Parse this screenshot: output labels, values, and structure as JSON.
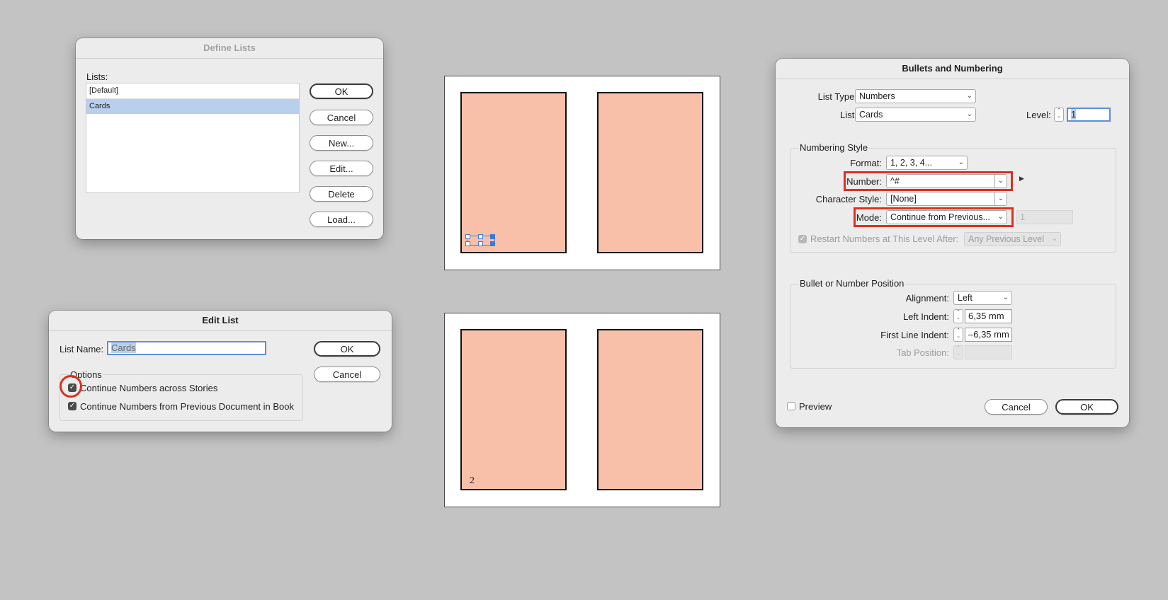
{
  "define_lists": {
    "title": "Define Lists",
    "lists_label": "Lists:",
    "items": [
      "[Default]",
      "Cards"
    ],
    "selected_index": 1,
    "buttons": {
      "ok": "OK",
      "cancel": "Cancel",
      "new": "New...",
      "edit": "Edit...",
      "delete": "Delete",
      "load": "Load..."
    }
  },
  "edit_list": {
    "title": "Edit List",
    "name_label": "List Name:",
    "name_value": "Cards",
    "options_title": "Options",
    "option1_label": "Continue Numbers across Stories",
    "option1_checked": true,
    "option2_label": "Continue Numbers from Previous Document in Book",
    "option2_checked": true,
    "ok": "OK",
    "cancel": "Cancel"
  },
  "pages": {
    "bottom_card_number": "2"
  },
  "bullets": {
    "title": "Bullets and Numbering",
    "list_type_label": "List Type:",
    "list_type_value": "Numbers",
    "list_label": "List:",
    "list_value": "Cards",
    "level_label": "Level:",
    "level_value": "1",
    "numbering_style_title": "Numbering Style",
    "format_label": "Format:",
    "format_value": "1, 2, 3, 4...",
    "number_label": "Number:",
    "number_value": "^#",
    "char_style_label": "Character Style:",
    "char_style_value": "[None]",
    "mode_label": "Mode:",
    "mode_value": "Continue from Previous...",
    "mode_start_value": "1",
    "restart_label": "Restart Numbers at This Level After:",
    "restart_value": "Any Previous Level",
    "position_title": "Bullet or Number Position",
    "alignment_label": "Alignment:",
    "alignment_value": "Left",
    "left_indent_label": "Left Indent:",
    "left_indent_value": "6,35 mm",
    "first_line_label": "First Line Indent:",
    "first_line_value": "–6,35 mm",
    "tab_position_label": "Tab Position:",
    "preview_label": "Preview",
    "cancel": "Cancel",
    "ok": "OK"
  },
  "colors": {
    "highlight": "#d8321f",
    "card_fill": "#f9c0a9",
    "selection": "#b8d0ee"
  }
}
